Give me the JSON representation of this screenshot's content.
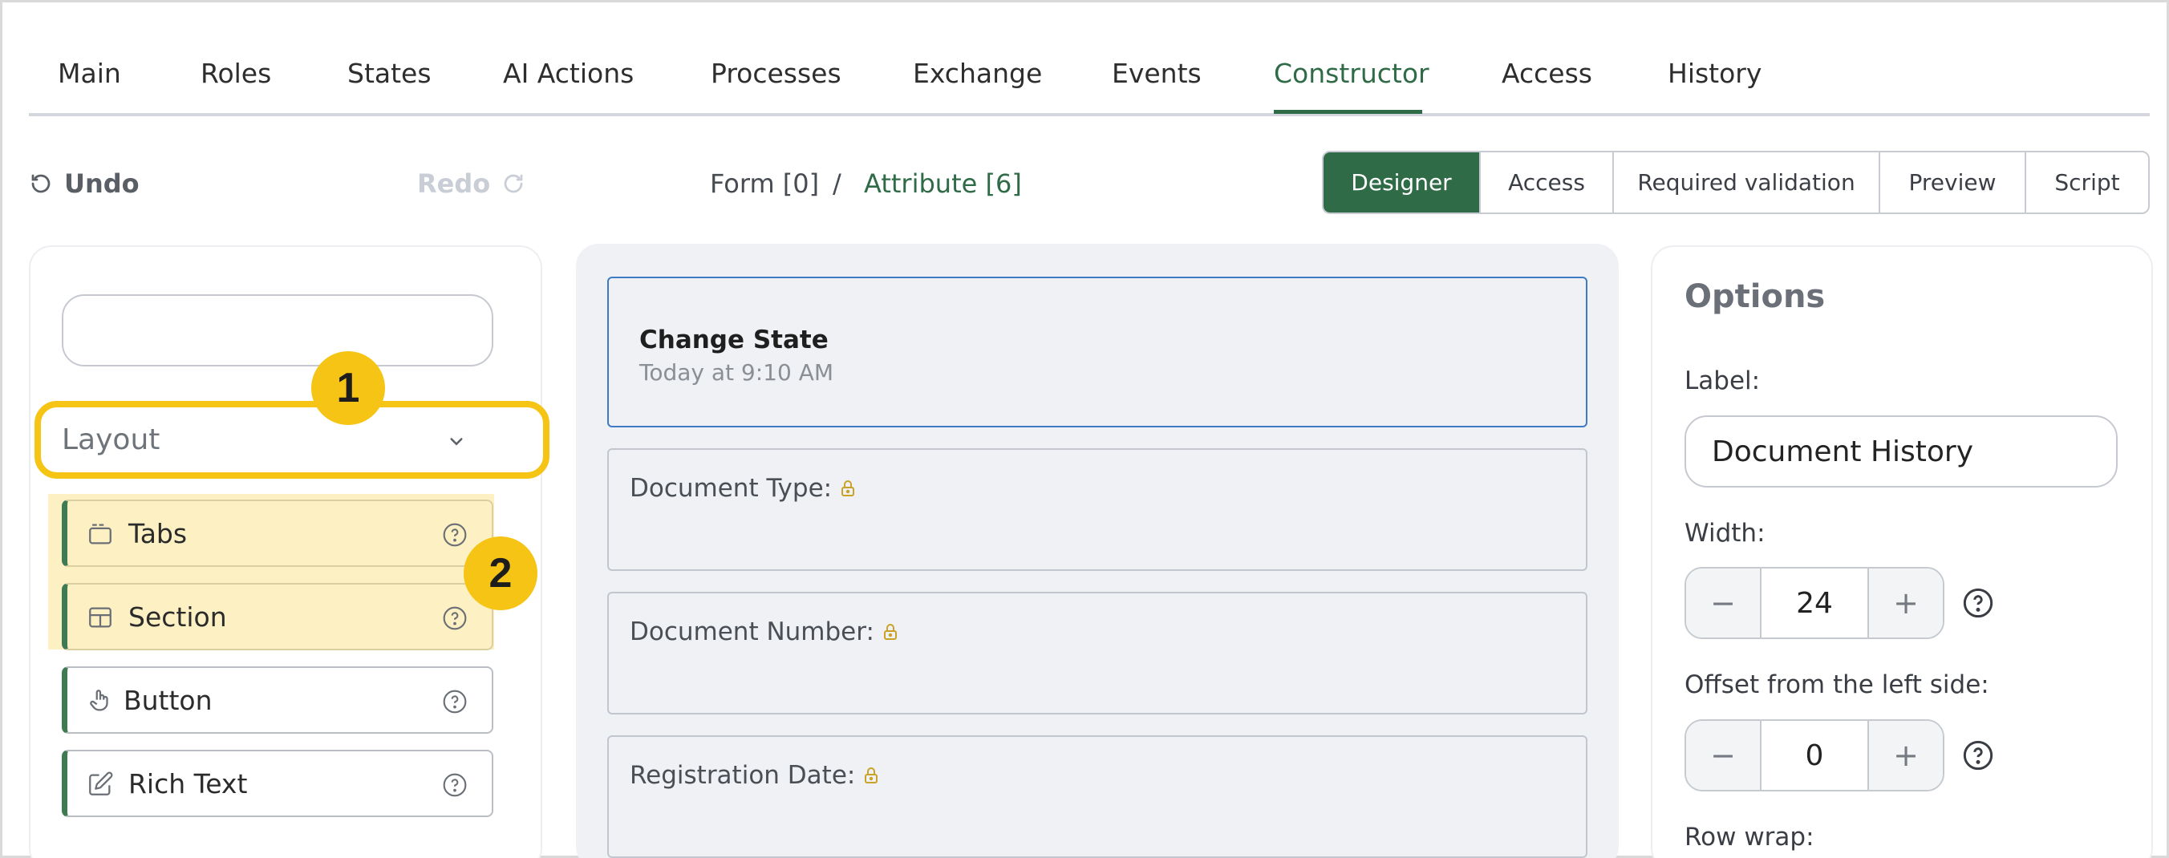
{
  "top_tabs": [
    {
      "label": "Main"
    },
    {
      "label": "Roles"
    },
    {
      "label": "States"
    },
    {
      "label": "AI Actions"
    },
    {
      "label": "Processes"
    },
    {
      "label": "Exchange"
    },
    {
      "label": "Events"
    },
    {
      "label": "Constructor",
      "active": true
    },
    {
      "label": "Access"
    },
    {
      "label": "History"
    }
  ],
  "toolbar": {
    "undo_label": "Undo",
    "redo_label": "Redo",
    "breadcrumb_form": "Form [0]",
    "breadcrumb_separator": "/",
    "breadcrumb_attribute": "Attribute [6]"
  },
  "mode_tabs": [
    {
      "label": "Designer",
      "active": true
    },
    {
      "label": "Access"
    },
    {
      "label": "Required validation"
    },
    {
      "label": "Preview"
    },
    {
      "label": "Script"
    }
  ],
  "palette": {
    "search_value": "",
    "group_label": "Layout",
    "items": [
      {
        "label": "Tabs",
        "icon": "tabs-icon",
        "highlighted": true
      },
      {
        "label": "Section",
        "icon": "section-icon",
        "highlighted": true
      },
      {
        "label": "Button",
        "icon": "pointer-hand-icon",
        "highlighted": false
      },
      {
        "label": "Rich Text",
        "icon": "edit-icon",
        "highlighted": false
      }
    ]
  },
  "callouts": [
    {
      "number": "1"
    },
    {
      "number": "2"
    }
  ],
  "canvas": {
    "selected_card": {
      "title": "Change State",
      "subtitle": "Today at 9:10 AM"
    },
    "fields": [
      {
        "label": "Document Type:",
        "locked": true
      },
      {
        "label": "Document Number:",
        "locked": true
      },
      {
        "label": "Registration Date:",
        "locked": true
      }
    ]
  },
  "options": {
    "title": "Options",
    "label_caption": "Label:",
    "label_value": "Document History",
    "width_caption": "Width:",
    "width_value": "24",
    "offset_caption": "Offset from the left side:",
    "offset_value": "0",
    "row_wrap_caption": "Row wrap:"
  },
  "colors": {
    "accent": "#2f6b47",
    "highlight": "#f5c414",
    "selected_border": "#3d7bc4"
  }
}
